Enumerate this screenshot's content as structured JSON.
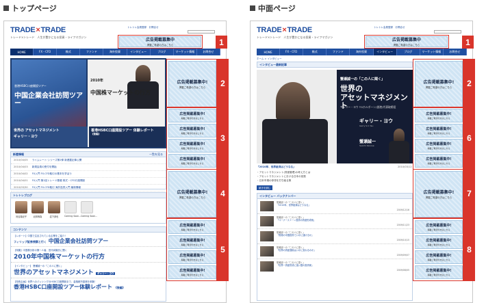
{
  "sections": {
    "top": "トップページ",
    "middle": "中面ページ"
  },
  "site": {
    "logo_a": "TRADE",
    "logo_sep": "×",
    "logo_b": "TRADE",
    "tagline": "トレード×トレード　人生が豊かになる投資・ライフマガジン",
    "toplinks": "トレトレ会員登録　お問合せ"
  },
  "nav": [
    "HOME",
    "FX・CFD",
    "株式",
    "ファンド",
    "海外投資",
    "インタビュー",
    "ブログ",
    "マーケット情報",
    "お問合せ"
  ],
  "ad": {
    "title": "広告掲載募集中!",
    "title_top": "広告掲載募集中",
    "sub": "掲載ご希望の方はこちら"
  },
  "numbers": [
    "1",
    "2",
    "3",
    "4",
    "5",
    "1",
    "6",
    "7",
    "8"
  ],
  "top": {
    "feature_cap": "香港HSBC口座開設ツアー",
    "feature_big": "中国企業会社訪問ツアー",
    "feature_year": "2010年",
    "feature_market": "中国株マーケットの行方",
    "thumb1": "世界の アセットマネジメント",
    "thumb1_name": "ギャリー・ヨウ",
    "thumb2": "香港HSBC口座開設ツアー 体験レポート",
    "thumb2_sub": "《後編》",
    "news_head": "新着情報",
    "news_more": "一覧を見る",
    "news": [
      {
        "d": "2010/04/05",
        "t": "ライムレート·シリーズ第2弾 新連載記事公開"
      },
      {
        "d": "2010/04/03",
        "t": "新規会員の受付を開始"
      },
      {
        "d": "2010/04/02",
        "t": "FX入門 FX-CFD取引の基本を学ぼう"
      },
      {
        "d": "2010/04/01",
        "t": "FX入門 第1回トレード基礎 株式・CFD口座開設"
      },
      {
        "d": "2010/03/30",
        "t": "FX入門 FX-CFD取引 海外投資入門 最新情報"
      }
    ],
    "blog_head": "トレトレブログ",
    "blog_names": [
      "河合真紀子",
      "北林琢為",
      "岩下彦也",
      "Coming Soon...",
      "Coming Soon..."
    ],
    "contents_head": "コンテンツ",
    "c1_small": "【レポート】中国で注目されている企業をご紹介！",
    "c1_pre": "フィリップ証券視察と行く",
    "c1_big": "中国企業会社訪問ツアー",
    "c2_small": "【特集】中国株分析の第一人者、田代尚機氏に聞く",
    "c2_big": "2010年中国株マーケットの行方",
    "c3_small": "【インタビュー】 蟹瀬誠一の「この人に聞く」",
    "c3_big": "世界のアセットマネジメント",
    "c3_badge": "ギャリー・ヨウ",
    "c4_small": "【特別企画】世界へのパッシングのHSBC口座開設まで、金融都市香港を体験！",
    "c4_big": "香港HSBC口座開設ツアー体験レポート",
    "c4_tail": "《後編》"
  },
  "middle": {
    "breadcrumb": "ホーム > インタビュー",
    "int_head": "インタビュー最新記事",
    "hero_pre": "蟹瀬誠一の「この人に聞く」",
    "hero_title1": "世界の",
    "hero_title2": "アセットマネジメント",
    "hero_guest": "ギャリー・ヨウ TGホルボーン(香港)代表取締役",
    "hero_name": "ギャリー・ヨウ",
    "hero_name_en": "Garry S.C.Yau",
    "hero_host": "蟹瀬誠一",
    "hero_host_en": "Seiichi Kanose",
    "link": "「2010年、世界経済はどうなる」",
    "link_date": "2010/03/12",
    "bullets": [
      "・アセットマネジメント(資産管理)の考え方とは",
      "・アセットマネジメントにおける日本の役割",
      "・日本市場の停滞を打ち破る策"
    ],
    "btn": "続きを読む",
    "bn_head": "インタビュー バックナンバー",
    "backnumbers": [
      {
        "g": "蟹瀬誠一の「この人に聞く」",
        "t": "「2010年、世界経済はどうなる」",
        "d": "2009/12/16"
      },
      {
        "g": "蟹瀬誠一の「この人に聞く」",
        "t": "「コーナーストーン投資の資産形成術」",
        "d": "2009/11/23"
      },
      {
        "g": "蟹瀬誠一の「この人に聞く」",
        "t": "「香港の中国投資でいかに儲けるか」",
        "d": "2009/10/15"
      },
      {
        "g": "蟹瀬誠一の「この人に聞く」",
        "t": "「世界の資産運用はいかに変わるのか」",
        "d": "2009/09/07"
      },
      {
        "g": "蟹瀬誠一の「この人に聞く」",
        "t": "「世界一資産形成に強い国の投資家」",
        "d": "2009/08/05"
      }
    ]
  }
}
